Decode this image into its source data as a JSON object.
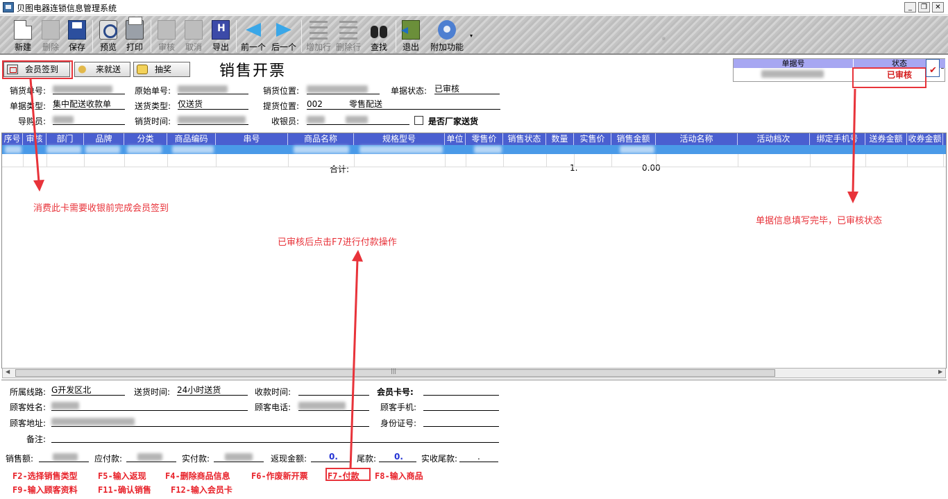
{
  "window": {
    "title": "贝图电器连锁信息管理系统",
    "min": "_",
    "restore": "❐",
    "close": "✕"
  },
  "toolbar": {
    "new": "新建",
    "delete": "删除",
    "save": "保存",
    "preview": "预览",
    "print": "打印",
    "approve": "审核",
    "unapprove": "取消",
    "export": "导出",
    "prev": "前一个",
    "next": "后一个",
    "add_row": "增加行",
    "del_row": "删除行",
    "find": "查找",
    "exit": "退出",
    "addon": "附加功能",
    "dropdown": "▾"
  },
  "top_buttons": {
    "member_checkin": "会员签到",
    "delivery": "来就送",
    "lottery": "抽奖"
  },
  "page_title": "销售开票",
  "status_panel": {
    "docno_label": "单据号",
    "status_label": "状态",
    "status_value": "已审核"
  },
  "form": {
    "sale_no": "销货单号:",
    "orig_no": "原始单号:",
    "sale_loc": "销货位置:",
    "doc_status": "单据状态:",
    "doc_status_val": "已审核",
    "doc_type": "单据类型:",
    "doc_type_val": "集中配送收款单",
    "send_type": "送货类型:",
    "send_type_val": "仅送货",
    "pick_loc": "提货位置:",
    "pick_loc_val": "002",
    "pick_loc_name": "零售配送",
    "guide": "导购员:",
    "sale_time": "销货时间:",
    "cashier": "收银员:",
    "factory_send": "是否厂家送货"
  },
  "grid": {
    "columns": [
      "序号",
      "审核",
      "部门",
      "品牌",
      "分类",
      "商品编码",
      "串号",
      "商品名称",
      "规格型号",
      "单位",
      "零售价",
      "销售状态",
      "数量",
      "实售价",
      "销售金额",
      "活动名称",
      "活动档次",
      "绑定手机号",
      "送券金额",
      "收券金额"
    ],
    "total_label": "合计:",
    "total_qty": "1.",
    "total_amount": "0.00"
  },
  "annotations": {
    "member": "消费此卡需要收银前完成会员签到",
    "status": "单据信息填写完毕，已审核状态",
    "pay": "已审核后点击F7进行付款操作"
  },
  "bottom": {
    "route": "所属线路:",
    "route_val": "G开发区北",
    "send_time": "送货时间:",
    "send_time_val": "24小时送货",
    "collect_time": "收款时间:",
    "member_card": "会员卡号:",
    "cust_name": "顾客姓名:",
    "cust_phone": "顾客电话:",
    "cust_mobile": "顾客手机:",
    "cust_addr": "顾客地址:",
    "id_no": "身份证号:",
    "remark": "备注:",
    "sale_amt": "销售额:",
    "due": "应付款:",
    "paid": "实付款:",
    "cashback": "返现金额:",
    "cashback_val": "0.",
    "tail": "尾款:",
    "tail_val": "0.",
    "real_tail": "实收尾款:",
    "real_tail_val": "."
  },
  "fkeys": {
    "f2": "F2-选择销售类型",
    "f5": "F5-输入返现",
    "f4": "F4-删除商品信息",
    "f6": "F6-作废新开票",
    "f7": "F7-付款",
    "f8": "F8-输入商品",
    "f9": "F9-输入顾客资料",
    "f11": "F11-确认销售",
    "f12": "F12-输入会员卡"
  },
  "colors": {
    "accent_red": "#e8333a",
    "grid_header": "#4a5fd0",
    "selected_row": "#4a9ae8",
    "status_header": "#a7a7f2",
    "blue_value": "#2433d4"
  }
}
